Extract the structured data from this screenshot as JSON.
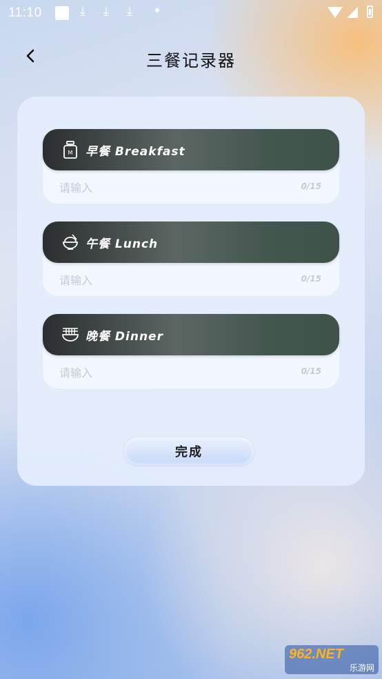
{
  "status_bar": {
    "time": "11:10"
  },
  "header": {
    "title": "三餐记录器"
  },
  "meals": [
    {
      "label": "早餐 Breakfast",
      "icon": "bottle-icon",
      "placeholder": "请输入",
      "value": "",
      "counter": "0/15"
    },
    {
      "label": "午餐 Lunch",
      "icon": "rice-bowl-icon",
      "placeholder": "请输入",
      "value": "",
      "counter": "0/15"
    },
    {
      "label": "晚餐 Dinner",
      "icon": "noodle-bowl-icon",
      "placeholder": "请输入",
      "value": "",
      "counter": "0/15"
    }
  ],
  "done_button": {
    "label": "完成"
  },
  "watermark": {
    "brand": "962.NET",
    "caption": "乐游网"
  },
  "colors": {
    "meal_header": "#3f5249",
    "card": "#e4eefc",
    "accent_orange": "#f8be78",
    "accent_blue": "#78a5eb"
  }
}
